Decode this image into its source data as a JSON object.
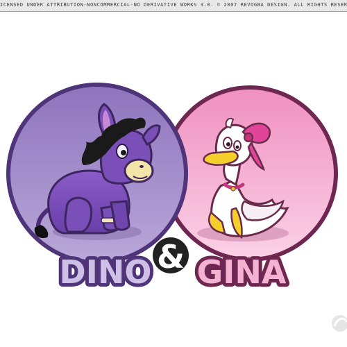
{
  "license": {
    "text": "ICENSED UNDER ATTRIBUTION-NONCOMMERCIAL-NO DERIVATIVE WORKS 3.0. © 2007 REVOGBA DESIGN. ALL RIGHTS RESERVED."
  },
  "logo": {
    "left_word": "DINO",
    "ampersand": "&",
    "right_word": "GINA"
  },
  "colors": {
    "left_circle": "#9a82c4",
    "right_circle": "#f2a8cf",
    "left_border": "#5a3d86",
    "right_border": "#7a2a55",
    "donkey_body": "#7a4fb8",
    "duck_bow": "#e0459a"
  },
  "icons": {
    "donkey": "donkey-character",
    "duck": "duck-character",
    "watermark": "watermark-logo"
  }
}
